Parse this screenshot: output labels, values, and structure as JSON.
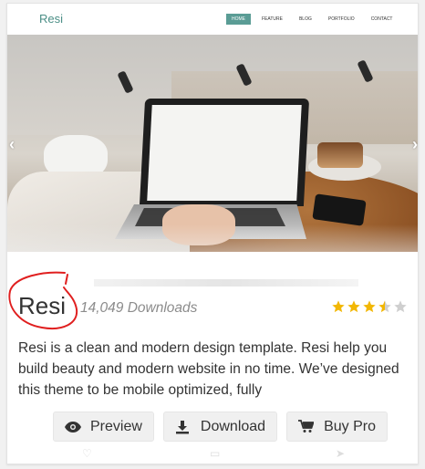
{
  "preview": {
    "site_logo": "Resi",
    "nav": [
      "HOME",
      "FEATURE",
      "BLOG",
      "PORTFOLIO",
      "CONTACT"
    ],
    "nav_active": "HOME",
    "arrows": {
      "left": "‹",
      "right": "›"
    }
  },
  "theme": {
    "title": "Resi",
    "downloads": "14,049 Downloads",
    "rating": {
      "value": 3.5,
      "max": 5
    },
    "description": "Resi is a clean and modern design template. Resi help you build beauty and modern website in no time. We’ve designed this theme to be mobile optimized, fully"
  },
  "buttons": {
    "preview": {
      "label": "Preview",
      "icon": "eye-icon"
    },
    "download": {
      "label": "Download",
      "icon": "download-icon"
    },
    "buy": {
      "label": "Buy Pro",
      "icon": "cart-icon"
    }
  },
  "colors": {
    "accent": "#5a9c95",
    "star": "#f2b705",
    "star_empty": "#cfcfcf",
    "scribble": "#e01f1f"
  }
}
